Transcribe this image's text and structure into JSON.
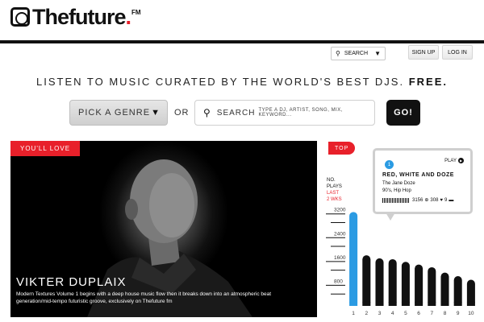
{
  "header": {
    "logo_text": "Thefuture",
    "logo_dot": ".",
    "logo_sup": "FM"
  },
  "topbar": {
    "search_label": "SEARCH",
    "signup_label": "SIGN UP",
    "login_label": "LOG IN"
  },
  "hero": {
    "tagline": "LISTEN TO MUSIC CURATED BY THE WORLD'S BEST DJS.",
    "tagline_emphasis": "FREE."
  },
  "search": {
    "genre_label": "PICK A GENRE",
    "or_label": "OR",
    "search_label": "SEARCH",
    "search_placeholder": "TYPE A DJ, ARTIST, SONG, MIX, KEYWORD...",
    "go_label": "GO!"
  },
  "feature": {
    "ribbon": "YOU'LL LOVE",
    "title": "VIKTER DUPLAIX",
    "description": "Modern Textures Volume 1 begins with a deep house music flow then it breaks down into an atmospheric beat generation/mid-tempo futuristic groove, exclusively on Thefuture fm"
  },
  "top_chart": {
    "tag": "TOP",
    "ylabel_line1": "NO.",
    "ylabel_line2": "PLAYS",
    "period_line1": "LAST",
    "period_line2": "2 WKS",
    "popup": {
      "rank": "1",
      "play_label": "PLAY",
      "title": "RED, WHITE AND DOZE",
      "artist": "The Jane Doze",
      "genre": "90's, Hip Hop",
      "plays": "3156",
      "likes": "308",
      "hearts": "9"
    }
  },
  "chart_data": {
    "type": "bar",
    "categories": [
      "1",
      "2",
      "3",
      "4",
      "5",
      "6",
      "7",
      "8",
      "9",
      "10"
    ],
    "values": [
      3156,
      1700,
      1600,
      1570,
      1480,
      1390,
      1300,
      1120,
      1000,
      880
    ],
    "ylabel": "NO. PLAYS LAST 2 WKS",
    "ylim": [
      0,
      3300
    ],
    "yticks": [
      800,
      1600,
      2400,
      3200
    ],
    "highlight_index": 0,
    "highlight_color": "#2b9be3",
    "bar_color": "#111111"
  },
  "colors": {
    "accent_red": "#e8202a",
    "accent_blue": "#2b9be3"
  }
}
